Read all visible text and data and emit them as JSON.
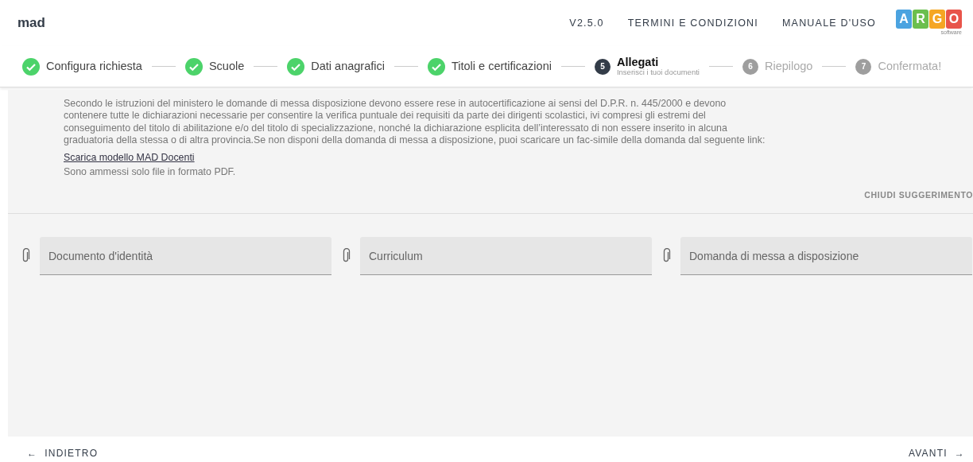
{
  "header": {
    "app_name": "mad",
    "links": [
      "V2.5.0",
      "TERMINI E CONDIZIONI",
      "MANUALE D'USO"
    ],
    "logo": {
      "letters": [
        {
          "text": "A",
          "color": "#4ba3e0"
        },
        {
          "text": "R",
          "color": "#6cbf4e"
        },
        {
          "text": "G",
          "color": "#f5a623"
        },
        {
          "text": "O",
          "color": "#e8544a"
        }
      ],
      "subtitle": "software"
    }
  },
  "steps": [
    {
      "label": "Configura richiesta",
      "completed": true,
      "selected": false
    },
    {
      "label": "Scuole",
      "completed": true,
      "selected": false
    },
    {
      "label": "Dati anagrafici",
      "completed": true,
      "selected": false
    },
    {
      "label": "Titoli e certificazioni",
      "completed": true,
      "selected": false
    },
    {
      "number": "5",
      "label": "Allegati",
      "subtitle": "Inserisci i tuoi documenti",
      "completed": false,
      "selected": true
    },
    {
      "number": "6",
      "label": "Riepilogo",
      "completed": false,
      "selected": false
    },
    {
      "number": "7",
      "label": "Confermata!",
      "completed": false,
      "selected": false
    }
  ],
  "hint": {
    "text": "Secondo le istruzioni del ministero le domande di messa disposizione devono essere rese in autocertificazione ai sensi del D.P.R. n. 445/2000 e devono contenere tutte le dichiarazioni necessarie per consentire la verifica puntuale dei requisiti da parte dei dirigenti scolastici, ivi compresi gli estremi del conseguimento del titolo di abilitazione e/o del titolo di specializzazione, nonché la dichiarazione esplicita dell’interessato di non essere inserito in alcuna graduatoria della stessa o di altra provincia.Se non disponi della domanda di messa a disposizione, puoi scaricare un fac-simile della domanda dal seguente link:",
    "link": "Scarica modello MAD Docenti",
    "note": "Sono ammessi solo file in formato PDF.",
    "close": "CHIUDI SUGGERIMENTO"
  },
  "attachments": [
    {
      "placeholder": "Documento d'identità"
    },
    {
      "placeholder": "Curriculum"
    },
    {
      "placeholder": "Domanda di messa a disposizione"
    }
  ],
  "footer": {
    "back": "INDIETRO",
    "back_arrow": "←",
    "next": "AVANTI",
    "next_arrow": "→"
  }
}
